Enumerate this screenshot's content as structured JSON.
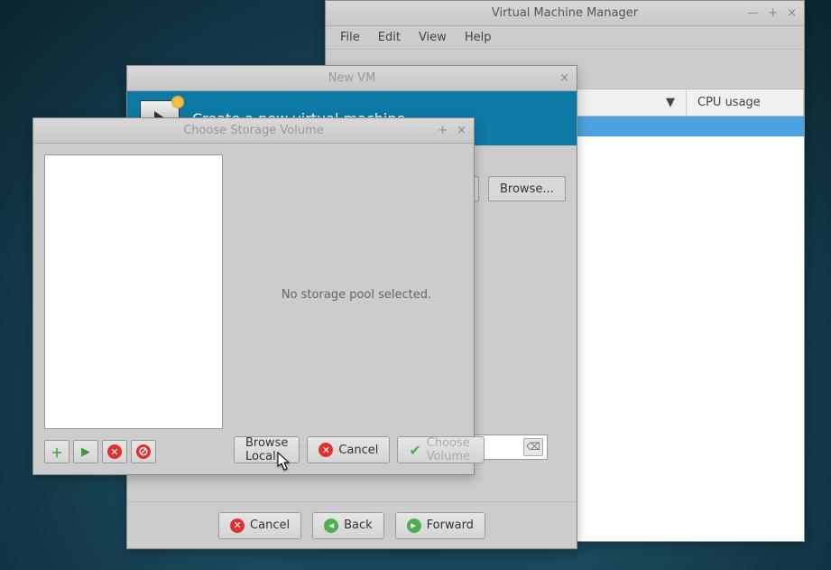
{
  "vmm": {
    "title": "Virtual Machine Manager",
    "menu": {
      "file": "File",
      "edit": "Edit",
      "view": "View",
      "help": "Help"
    },
    "columns": {
      "name_sort": "▼",
      "cpu": "CPU usage"
    }
  },
  "newvm": {
    "window_title": "New VM",
    "banner_title": "Create a new virtual machine",
    "browse": "Browse...",
    "footer": {
      "cancel": "Cancel",
      "back": "Back",
      "forward": "Forward"
    }
  },
  "csv": {
    "title": "Choose Storage Volume",
    "empty": "No storage pool selected.",
    "browse_local": "Browse Local",
    "cancel": "Cancel",
    "choose_volume": "Choose Volume"
  }
}
